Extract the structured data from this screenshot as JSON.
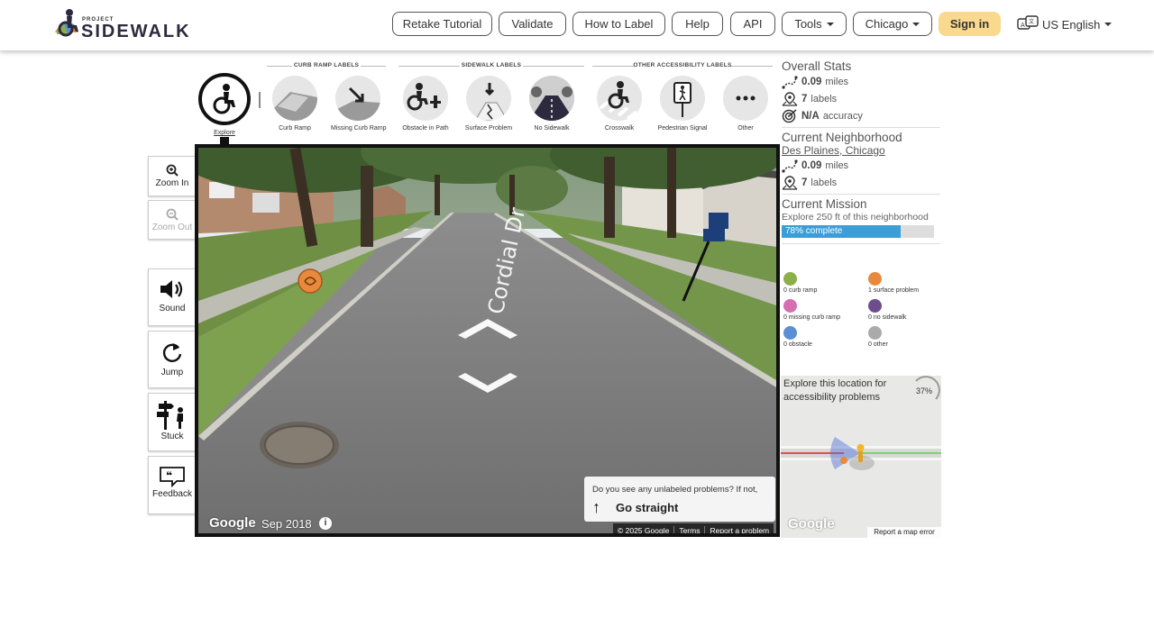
{
  "app": {
    "logo_small": "PROJECT",
    "logo_name": "SIDEWALK"
  },
  "nav": {
    "buttons": [
      "Retake Tutorial",
      "Validate",
      "How to Label",
      "Help",
      "API"
    ],
    "tools_label": "Tools",
    "city_label": "Chicago",
    "signin_label": "Sign in",
    "language_label": "US English"
  },
  "toolbar": {
    "sections": [
      "CURB RAMP LABELS",
      "SIDEWALK LABELS",
      "OTHER ACCESSIBILITY LABELS"
    ],
    "tools": [
      {
        "label": "Explore",
        "icon": "wheelchair-explore-icon"
      },
      {
        "label": "Curb Ramp",
        "icon": "curb-ramp-icon"
      },
      {
        "label": "Missing Curb Ramp",
        "icon": "missing-curb-ramp-icon"
      },
      {
        "label": "Obstacle in Path",
        "icon": "obstacle-icon"
      },
      {
        "label": "Surface Problem",
        "icon": "surface-problem-icon"
      },
      {
        "label": "No Sidewalk",
        "icon": "no-sidewalk-icon"
      },
      {
        "label": "Crosswalk",
        "icon": "crosswalk-icon"
      },
      {
        "label": "Pedestrian Signal",
        "icon": "pedestrian-signal-icon"
      },
      {
        "label": "Other",
        "icon": "more-dots-icon"
      }
    ]
  },
  "controls": {
    "zoom_in": "Zoom In",
    "zoom_out": "Zoom Out",
    "sound": "Sound",
    "jump": "Jump",
    "stuck": "Stuck",
    "feedback": "Feedback"
  },
  "pano": {
    "street_name": "Cordial Dr",
    "google": "Google",
    "date": "Sep 2018",
    "hint_question": "Do you see any unlabeled problems? If not,",
    "hint_action": "Go straight",
    "copyright": "© 2025 Google",
    "terms": "Terms",
    "report": "Report a problem"
  },
  "stats": {
    "overall_title": "Overall Stats",
    "overall_miles_value": "0.09",
    "miles_unit": "miles",
    "overall_labels_value": "7",
    "labels_unit": "labels",
    "accuracy_value": "N/A",
    "accuracy_unit": "accuracy",
    "neighborhood_title": "Current Neighborhood",
    "neighborhood_name": "Des Plaines, Chicago",
    "neigh_miles_value": "0.09",
    "neigh_labels_value": "7",
    "mission_title": "Current Mission",
    "mission_text": "Explore 250 ft of this neighborhood",
    "mission_progress_text": "78% complete",
    "mission_progress": 0.78
  },
  "legend": [
    {
      "text": "0 curb ramp",
      "color": "#8bb04a"
    },
    {
      "text": "1 surface problem",
      "color": "#e8893b"
    },
    {
      "text": "0 missing curb ramp",
      "color": "#d66fb0"
    },
    {
      "text": "0 no sidewalk",
      "color": "#6e4d8c"
    },
    {
      "text": "0 obstacle",
      "color": "#5b8fd4"
    },
    {
      "text": "0 other",
      "color": "#aaaaaa"
    }
  ],
  "minimap": {
    "text": "Explore this location for accessibility problems",
    "percent": "37%",
    "google": "Google",
    "report": "Report a map error"
  }
}
